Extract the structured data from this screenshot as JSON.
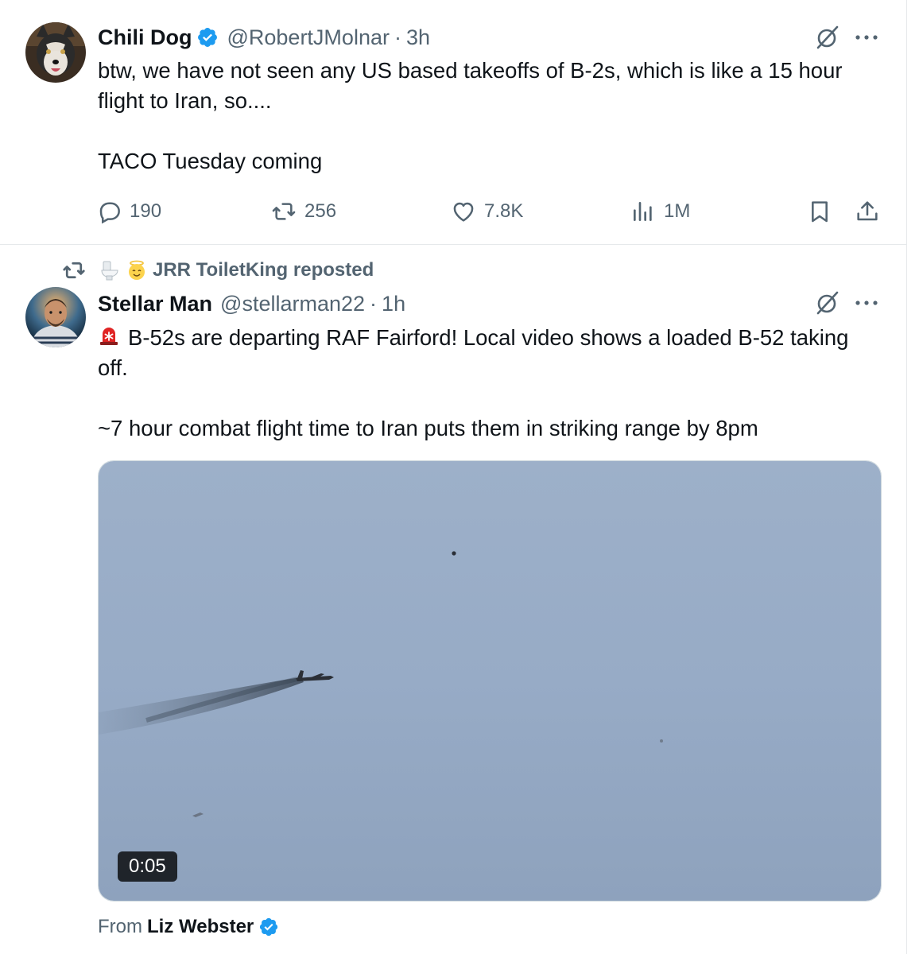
{
  "colors": {
    "verified": "#1d9bf0",
    "secondary_text": "#536471",
    "primary_text": "#0f1419",
    "sky": "#93a9c6"
  },
  "tweets": [
    {
      "author_name": "Chili Dog",
      "handle": "@RobertJMolnar",
      "separator": "·",
      "time": "3h",
      "verified": true,
      "avatar": "husky-dog-avatar",
      "text": "btw, we have not seen any US based takeoffs of B-2s, which is like a 15 hour flight to Iran, so....\n\nTACO Tuesday coming",
      "actions": {
        "replies": "190",
        "reposts": "256",
        "likes": "7.8K",
        "views": "1M"
      }
    },
    {
      "social_context": "JRR ToiletKing reposted",
      "author_name": "Stellar Man",
      "handle": "@stellarman22",
      "separator": "·",
      "time": "1h",
      "verified": false,
      "avatar": "astronaut-avatar",
      "alert_emoji": "rotating-light-icon",
      "text": "B-52s are departing RAF Fairford! Local video shows a loaded B-52 taking off.\n\n~7 hour combat flight time to Iran puts them in striking range by 8pm",
      "media": {
        "type": "video",
        "duration": "0:05",
        "description_icon": "b52-bomber-in-sky"
      },
      "source_prefix": "From",
      "source_name": "Liz Webster",
      "source_verified": true
    }
  ]
}
